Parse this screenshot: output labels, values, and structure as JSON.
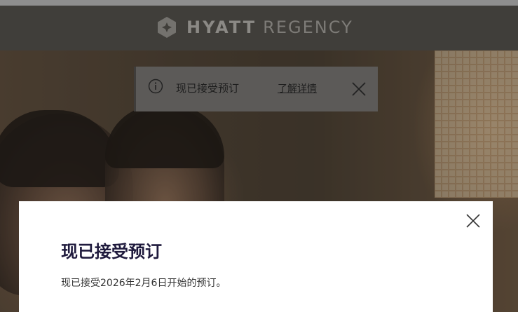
{
  "header": {
    "brand_bold": "HYATT",
    "brand_light": "REGENCY",
    "logo_icon": "hyatt-regency-diamond-logo"
  },
  "notice": {
    "icon": "info-circle-icon",
    "text": "现已接受预订",
    "link_label": "了解详情",
    "close_icon": "close-icon"
  },
  "modal": {
    "title": "现已接受预订",
    "body": "现已接受2026年2月6日开始的预订。",
    "close_icon": "close-icon"
  },
  "colors": {
    "header_bg": "#403e3a",
    "notice_bg": "#5c5a58",
    "modal_bg": "#ffffff",
    "modal_title": "#1f1a3d"
  }
}
